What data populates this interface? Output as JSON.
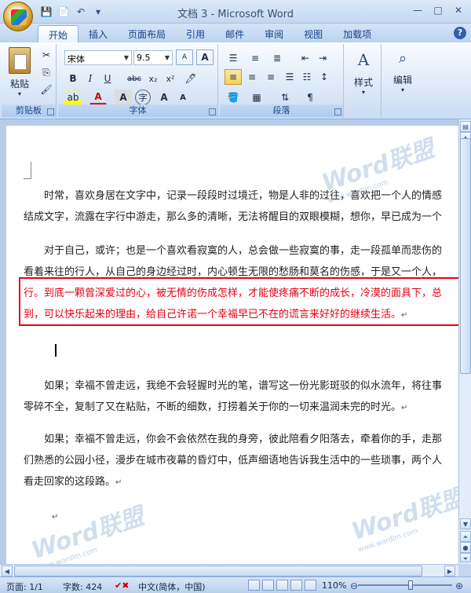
{
  "window": {
    "title": "文档 3 - Microsoft Word"
  },
  "quick_access": {
    "icons": [
      "save-icon",
      "new-doc-icon",
      "undo-icon",
      "quick-access-dropdown-icon"
    ]
  },
  "tabs": [
    "开始",
    "插入",
    "页面布局",
    "引用",
    "邮件",
    "审阅",
    "视图",
    "加载项"
  ],
  "active_tab": "开始",
  "ribbon": {
    "clipboard": {
      "label": "剪贴板",
      "paste_label": "粘贴"
    },
    "font": {
      "label": "字体",
      "font_name": "宋体",
      "font_size": "9.5",
      "buttons": [
        "B",
        "I",
        "U",
        "abc",
        "x₂",
        "x²",
        "A",
        "A",
        "A"
      ]
    },
    "paragraph": {
      "label": "段落"
    },
    "styles": {
      "label": "样式"
    },
    "editing": {
      "label": "编辑"
    }
  },
  "document": {
    "paragraphs": [
      {
        "lines": [
          "时常，喜欢身居在文字中，记录一段段时过境迁，物是人非的过往，喜欢把一个人的情感",
          "结成文字，流露在字行中游走，那么多的清晰，无法将醒目的双眼模糊，想你，早已成为一个"
        ]
      },
      {
        "lines": [
          "对于自己，或许；也是一个喜欢看寂寞的人，总会做一些寂寞的事，走一段孤单而悲伤的",
          "看着来往的行人，从自己的身边经过时，内心顿生无限的愁肠和莫名的伤感，于是又一个人，",
          "行。到底一颗曾深爱过的心，被无情的伤成怎样，才能使疼痛不断的成长，冷漠的面具下，总",
          "到，可以快乐起来的理由，给自己许诺一个幸福早已不在的谎言来好好的继续生活。"
        ]
      },
      {
        "lines": [
          "如果；幸福不曾走远，我绝不会轻握时光的笔，谱写这一份光影斑驳的似水流年，将往事",
          "零碎不全，复制了又在粘贴，不断的细数，打捞着关于你的一切来温润未完的时光。"
        ]
      },
      {
        "lines": [
          "如果；幸福不曾走远，你会不会依然在我的身旁，彼此陪看夕阳落去，牵着你的手，走那",
          "们熟悉的公园小径，漫步在城市夜幕的昏灯中，低声细语地告诉我生活中的一些琐事，两个人",
          "看走回家的这段路。"
        ]
      }
    ],
    "paragraph_mark": "↵",
    "watermark": {
      "text": "Word联盟",
      "url": "www.wordlm.com"
    }
  },
  "status": {
    "page": "页面: 1/1",
    "words": "字数: 424",
    "language": "中文(简体，中国)",
    "zoom": "110%"
  },
  "colors": {
    "highlight": "#e60012",
    "ribbon_text": "#15428b"
  }
}
